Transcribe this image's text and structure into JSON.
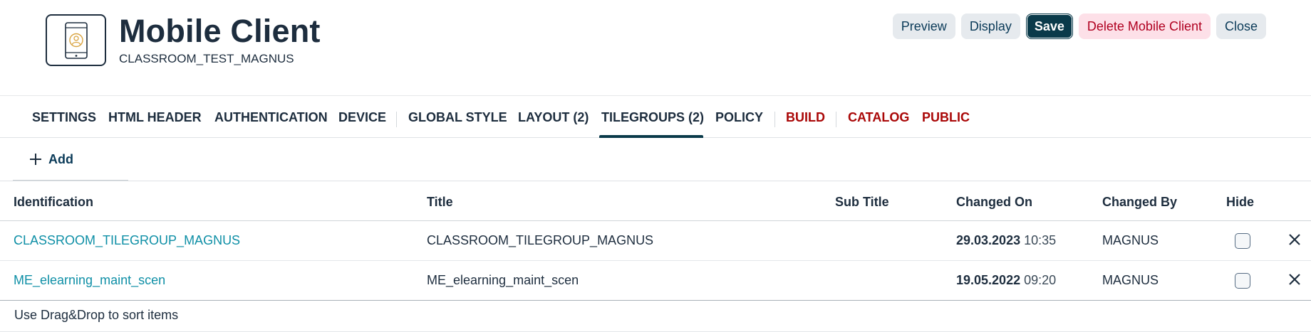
{
  "header": {
    "title": "Mobile Client",
    "subtitle": "CLASSROOM_TEST_MAGNUS",
    "avatar_icon": "tablet-user-icon",
    "actions": {
      "preview": "Preview",
      "display": "Display",
      "save": "Save",
      "delete": "Delete Mobile Client",
      "close": "Close"
    }
  },
  "tabs": [
    {
      "label": "SETTINGS",
      "color": "default"
    },
    {
      "label": "HTML HEADER",
      "color": "default"
    },
    {
      "label": "AUTHENTICATION",
      "color": "default"
    },
    {
      "label": "DEVICE",
      "color": "default"
    },
    {
      "label": "GLOBAL STYLE",
      "color": "default"
    },
    {
      "label": "LAYOUT (2)",
      "color": "default"
    },
    {
      "label": "TILEGROUPS (2)",
      "color": "default",
      "selected": true
    },
    {
      "label": "POLICY",
      "color": "default"
    },
    {
      "label": "BUILD",
      "color": "red"
    },
    {
      "label": "CATALOG",
      "color": "red"
    },
    {
      "label": "PUBLIC",
      "color": "red"
    }
  ],
  "toolbar": {
    "add_label": "Add",
    "add_icon": "plus-icon"
  },
  "table": {
    "columns": {
      "identification": "Identification",
      "title": "Title",
      "sub_title": "Sub Title",
      "changed_on": "Changed On",
      "changed_by": "Changed By",
      "hide": "Hide"
    },
    "rows": [
      {
        "identification": "CLASSROOM_TILEGROUP_MAGNUS",
        "title": "CLASSROOM_TILEGROUP_MAGNUS",
        "sub_title": "",
        "date": "29.03.2023",
        "time": "10:35",
        "changed_by": "MAGNUS",
        "hide": false
      },
      {
        "identification": "ME_elearning_maint_scen",
        "title": "ME_elearning_maint_scen",
        "sub_title": "",
        "date": "19.05.2022",
        "time": "09:20",
        "changed_by": "MAGNUS",
        "hide": false
      }
    ]
  },
  "footer": {
    "hint": "Use Drag&Drop to sort items"
  },
  "colors": {
    "primary": "#0a3a4a",
    "link": "#0e8fa6",
    "danger": "#aa0808",
    "danger_bg": "#fde0e8"
  }
}
